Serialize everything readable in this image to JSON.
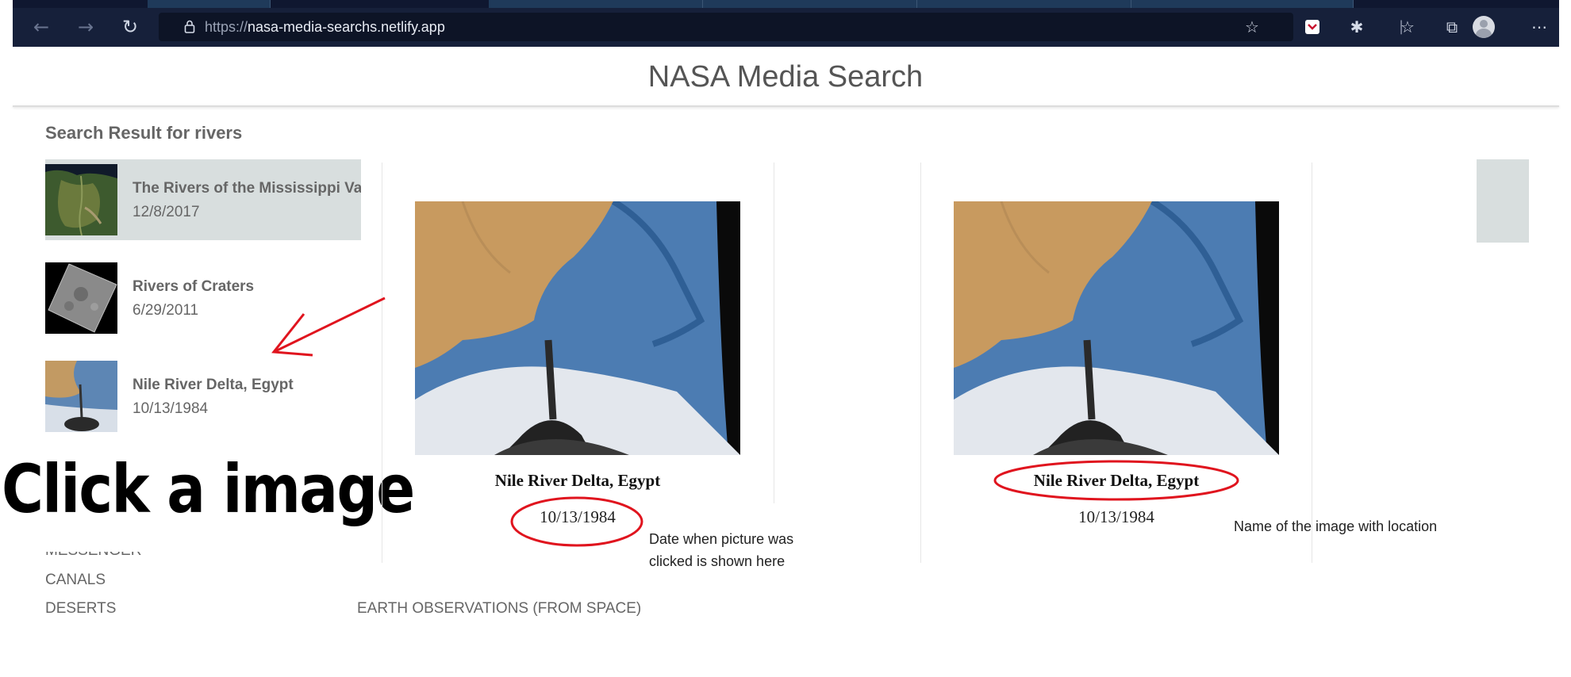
{
  "browser": {
    "url_protocol": "https://",
    "url_host": "nasa-media-searchs.netlify.app",
    "icons": [
      "back-icon",
      "forward-icon",
      "refresh-icon",
      "lock-icon",
      "add-favorite-icon",
      "pocket-icon",
      "extensions-icon",
      "favorites-icon",
      "collections-icon",
      "profile-icon",
      "more-icon"
    ]
  },
  "page": {
    "title": "NASA Media Search",
    "result_heading": "Search Result for rivers"
  },
  "results": [
    {
      "title": "The Rivers of the Mississippi Valley",
      "date": "12/8/2017"
    },
    {
      "title": "Rivers of Craters",
      "date": "6/29/2011"
    },
    {
      "title": "Nile River Delta, Egypt",
      "date": "10/13/1984"
    }
  ],
  "keywords": {
    "left": [
      "MESSENGER",
      "CANALS",
      "DESERTS"
    ],
    "right": [
      "EARTH OBSERVATIONS (FROM SPACE)"
    ]
  },
  "detail_cards": [
    {
      "title": "Nile River Delta, Egypt",
      "date": "10/13/1984"
    },
    {
      "title": "Nile River Delta, Egypt",
      "date": "10/13/1984"
    }
  ],
  "annotations": {
    "click_instruction": "Click a image",
    "date_note_line1": "Date when picture was",
    "date_note_line2": "clicked is shown here",
    "name_note": "Name of the image with location",
    "highlight_color": "#e0141e"
  }
}
